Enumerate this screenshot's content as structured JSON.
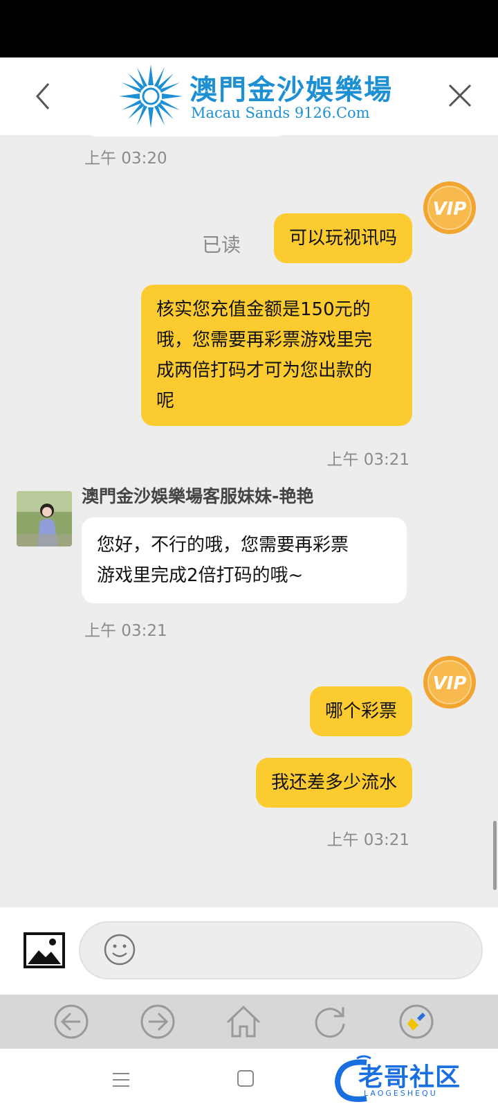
{
  "header": {
    "logo_cn": "澳門金沙娛樂場",
    "logo_en": "Macau Sands 9126.Com"
  },
  "messages": {
    "ts_1": "上午 03:20",
    "read_status": "已读",
    "user_msg_1": "可以玩视讯吗",
    "user_msg_2_lines": [
      "核实您充值金额是150元的",
      "哦，您需要再彩票游戏里完",
      "成两倍打码才可为您出款的",
      "呢"
    ],
    "ts_2": "上午 03:21",
    "agent_name": "澳門金沙娛樂場客服妹妹-艳艳",
    "agent_msg_lines": [
      "您好，不行的哦，您需要再彩票",
      "游戏里完成2倍打码的哦~"
    ],
    "ts_3": "上午 03:21",
    "user_msg_3": "哪个彩票",
    "user_msg_4": "我还差多少流水",
    "ts_4": "上午 03:21"
  },
  "vip_badge": "VIP",
  "watermark": {
    "text": "老哥社区",
    "sub": "LAOGESHEQU"
  },
  "colors": {
    "user_bubble": "#fccb30",
    "agent_bubble": "#ffffff",
    "chat_bg": "#ededed",
    "logo_blue": "#1d8fd3",
    "vip_gold": "#f2a431"
  }
}
